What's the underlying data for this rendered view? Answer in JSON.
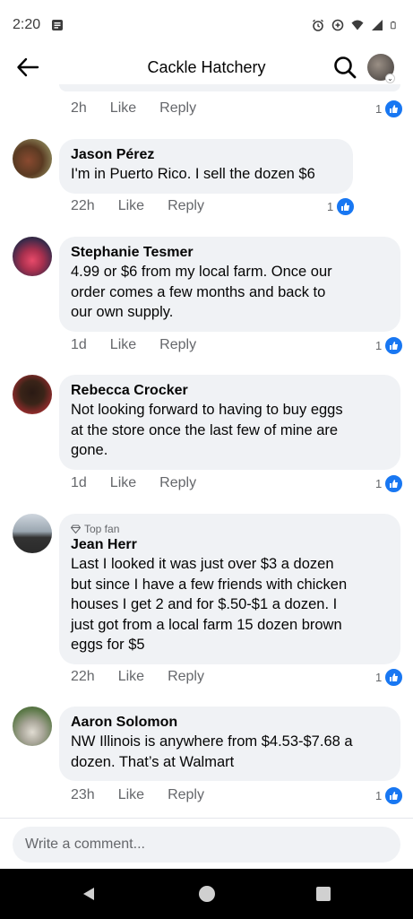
{
  "status_bar": {
    "time": "2:20"
  },
  "header": {
    "title": "Cackle Hatchery"
  },
  "top_comment_meta": {
    "time": "2h",
    "like": "Like",
    "reply": "Reply",
    "reactions": "1"
  },
  "comments": [
    {
      "name": "Jason Pérez",
      "text": "I'm in Puerto Rico. I sell the dozen $6",
      "time": "22h",
      "like": "Like",
      "reply": "Reply",
      "reactions": "1"
    },
    {
      "name": "Stephanie Tesmer",
      "lines": [
        "4.99 or $6 from my local farm. Once our",
        "order comes a few months and back to",
        "our own supply."
      ],
      "time": "1d",
      "like": "Like",
      "reply": "Reply",
      "reactions": "1"
    },
    {
      "name": "Rebecca Crocker",
      "lines": [
        "Not looking forward to having to buy eggs",
        "at the store once the last few of mine are",
        "gone."
      ],
      "time": "1d",
      "like": "Like",
      "reply": "Reply",
      "reactions": "1"
    },
    {
      "badge": "Top fan",
      "name": "Jean Herr",
      "lines": [
        "Last I looked it was just over $3 a dozen",
        "but since I have a few friends with chicken",
        "houses I get 2 and for $.50-$1 a dozen. I",
        "just got from a local farm 15 dozen brown",
        "eggs for $5"
      ],
      "time": "22h",
      "like": "Like",
      "reply": "Reply",
      "reactions": "1"
    },
    {
      "name": "Aaron Solomon",
      "lines": [
        "NW Illinois is anywhere from $4.53-$7.68 a",
        "dozen.  That’s at Walmart"
      ],
      "time": "23h",
      "like": "Like",
      "reply": "Reply",
      "reactions": "1"
    }
  ],
  "composer": {
    "placeholder": "Write a comment..."
  },
  "colors": {
    "accent": "#1877f2",
    "bubble": "#f0f2f5",
    "meta": "#65676b"
  }
}
